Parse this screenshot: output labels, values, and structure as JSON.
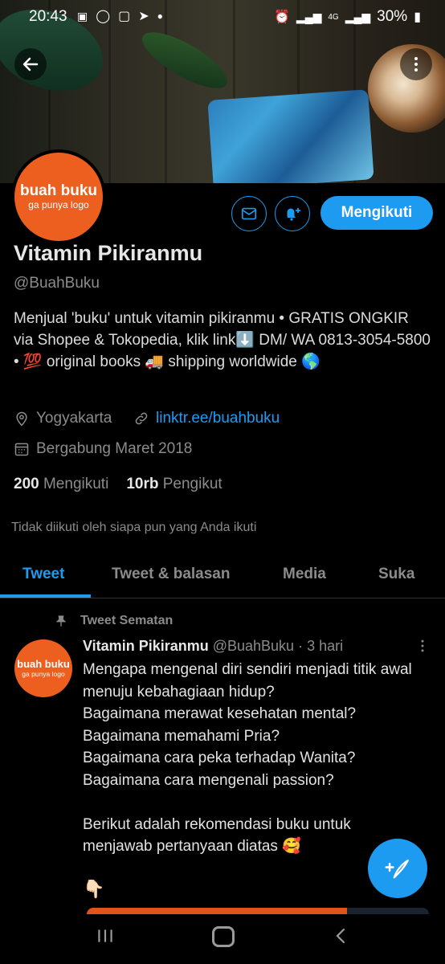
{
  "status_bar": {
    "time": "20:43",
    "network": "4G",
    "battery": "30%"
  },
  "profile": {
    "avatar_line1": "buah buku",
    "avatar_line2": "ga punya logo",
    "name": "Vitamin Pikiranmu",
    "handle": "@BuahBuku",
    "follow_label": "Mengikuti",
    "bio": "Menjual 'buku' untuk vitamin pikiranmu • GRATIS ONGKIR via Shopee & Tokopedia, klik link⬇️ DM/ WA 0813-3054-5800 • 💯 original books 🚚 shipping worldwide 🌎",
    "location": "Yogyakarta",
    "link": "linktr.ee/buahbuku",
    "joined": "Bergabung Maret 2018",
    "following_count": "200",
    "following_label": "Mengikuti",
    "followers_count": "10rb",
    "followers_label": "Pengikut",
    "not_followed_text": "Tidak diikuti oleh siapa pun yang Anda ikuti"
  },
  "tabs": [
    {
      "label": "Tweet",
      "active": true
    },
    {
      "label": "Tweet & balasan",
      "active": false
    },
    {
      "label": "Media",
      "active": false
    },
    {
      "label": "Suka",
      "active": false
    }
  ],
  "pinned_tweet": {
    "pinned_label": "Tweet Sematan",
    "author_name": "Vitamin Pikiranmu",
    "author_handle": "@BuahBuku",
    "time": "· 3 hari",
    "body": "Mengapa mengenal diri sendiri menjadi titik awal menuju kebahagiaan hidup?\nBagaimana merawat kesehatan mental?\nBagaimana memahami Pria?\nBagaimana cara peka terhadap Wanita?\nBagaimana cara mengenali passion?\n\nBerikut adalah rekomendasi buku untuk menjawab pertanyaan diatas 🥰",
    "trailing_emoji": "👇🏻"
  },
  "colors": {
    "accent": "#1d9bf0",
    "brand_orange": "#ed5f1e",
    "background": "#000000"
  }
}
